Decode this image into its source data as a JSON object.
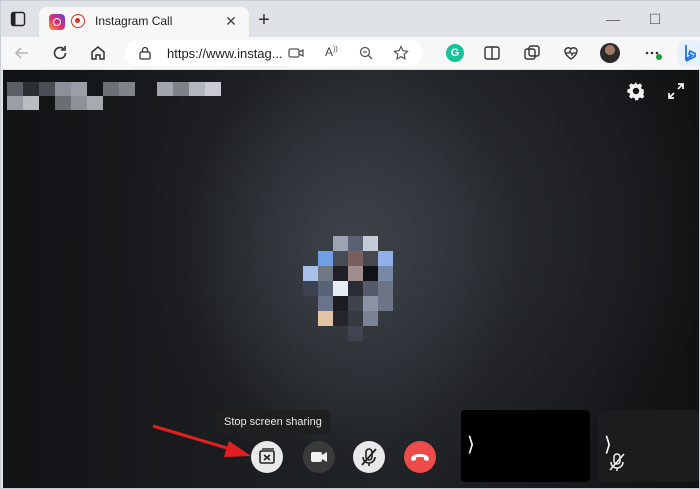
{
  "browser": {
    "tab": {
      "title": "Instagram Call"
    },
    "new_tab_label": "+",
    "address": {
      "url": "https://www.instag..."
    },
    "icons": {
      "back": "back-arrow-icon",
      "refresh": "refresh-icon",
      "home": "home-icon",
      "lock": "lock-icon",
      "camera": "camera-icon",
      "read_aloud": "read-aloud-icon",
      "zoom": "zoom-out-icon",
      "favorite": "star-icon",
      "grammarly": "grammarly-icon",
      "split_screen": "split-screen-icon",
      "collections": "collections-icon",
      "health": "browser-essentials-icon",
      "profile": "profile-avatar",
      "more": "more-icon",
      "bing": "bing-icon"
    },
    "grammarly_letter": "G"
  },
  "call": {
    "tooltip": "Stop screen sharing",
    "controls": [
      {
        "name": "stop-screen-sharing",
        "icon": "stop-share-icon"
      },
      {
        "name": "camera",
        "icon": "video-camera-icon"
      },
      {
        "name": "microphone",
        "icon": "mic-off-icon"
      },
      {
        "name": "end-call",
        "icon": "hang-up-icon"
      }
    ],
    "tiles": [
      {
        "chevron": "⟩"
      },
      {
        "chevron": "⟩",
        "muted": true
      }
    ],
    "colors": {
      "hangup": "#ee4b4b",
      "annotation_arrow": "#e02020"
    }
  }
}
